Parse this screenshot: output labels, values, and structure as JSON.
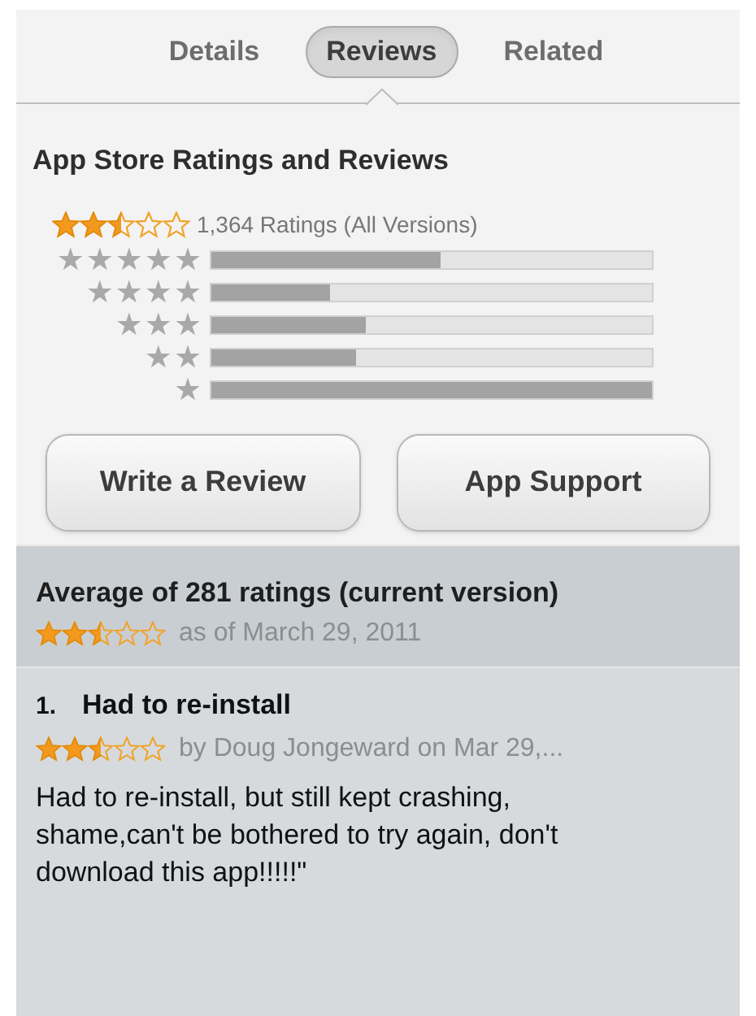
{
  "tabs": [
    {
      "label": "Details",
      "selected": false
    },
    {
      "label": "Reviews",
      "selected": true
    },
    {
      "label": "Related",
      "selected": false
    }
  ],
  "ratings": {
    "title": "App Store Ratings and Reviews",
    "stars": 2.5,
    "count": "1,364 Ratings (All Versions)",
    "histogram": [
      {
        "label": "★★★★★",
        "level": 0.52
      },
      {
        "label": "★★★★",
        "level": 0.27
      },
      {
        "label": "★★★",
        "level": 0.35
      },
      {
        "label": "★★",
        "level": 0.33
      },
      {
        "label": "★",
        "level": 1.0
      }
    ]
  },
  "buttons": [
    "Write a Review",
    "App Support"
  ],
  "average": {
    "title": "Average of 281 ratings (current version)",
    "stars": 2.5,
    "date": "as of March 29, 2011"
  },
  "reviews": [
    {
      "number": "1.",
      "title": "Had to re-install",
      "stars": 2.5,
      "byline": "by Doug Jongeward on Mar 29,...",
      "body": "Had to re-install, but still kept crashing, shame,can't be bothered to try again, don't download this app!!!!!\""
    }
  ]
}
